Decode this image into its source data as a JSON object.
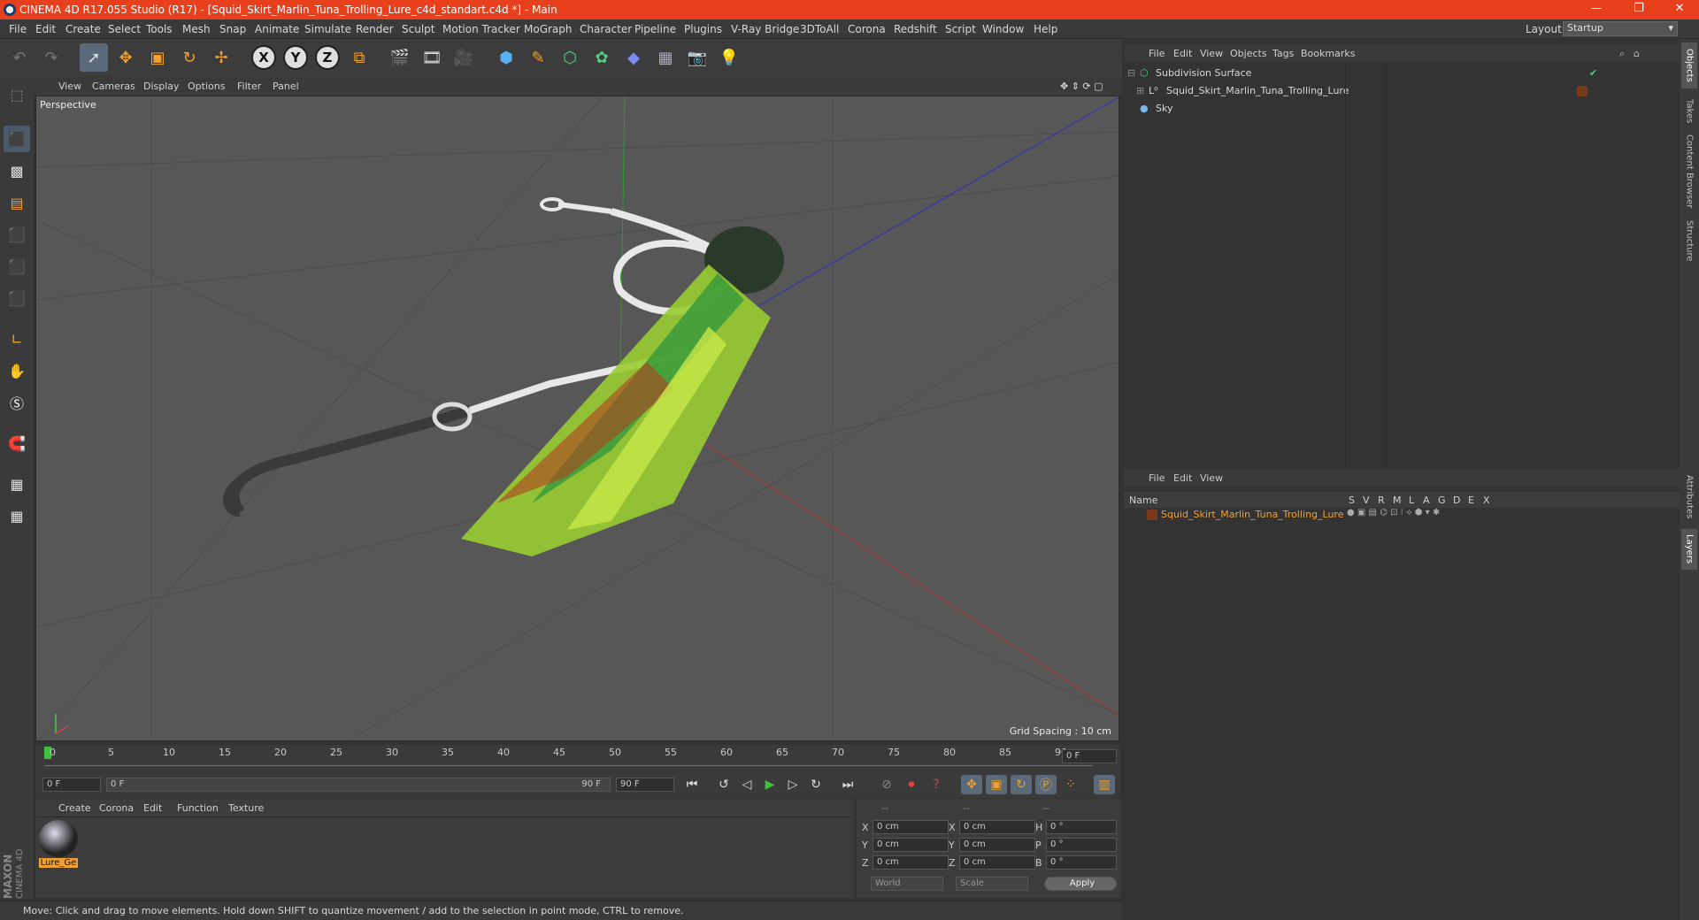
{
  "title_bar": {
    "title": "CINEMA 4D R17.055 Studio (R17) - [Squid_Skirt_Marlin_Tuna_Trolling_Lure_c4d_standart.c4d *] - Main",
    "minimize": "—",
    "restore": "❐",
    "close": "✕"
  },
  "menubar": {
    "items": [
      "File",
      "Edit",
      "Create",
      "Select",
      "Tools",
      "Mesh",
      "Snap",
      "Animate",
      "Simulate",
      "Render",
      "Sculpt",
      "Motion Tracker",
      "MoGraph",
      "Character",
      "Pipeline",
      "Plugins",
      "V-Ray Bridge",
      "3DToAll",
      "Corona",
      "Redshift",
      "Script",
      "Window",
      "Help"
    ],
    "layout_label": "Layout:",
    "layout_value": "Startup"
  },
  "viewport": {
    "menu": [
      "View",
      "Cameras",
      "Display",
      "Options",
      "Filter",
      "Panel"
    ],
    "camera_label": "Perspective",
    "grid_spacing": "Grid Spacing : 10 cm"
  },
  "timeline": {
    "ticks": [
      "0",
      "5",
      "10",
      "15",
      "20",
      "25",
      "30",
      "35",
      "40",
      "45",
      "50",
      "55",
      "60",
      "65",
      "70",
      "75",
      "80",
      "85",
      "90"
    ],
    "end_field": "0 F",
    "start_frame": "0 F",
    "range_start": "0 F",
    "range_end": "90 F",
    "end_frame": "90 F"
  },
  "material_manager": {
    "menu": [
      "Create",
      "Corona",
      "Edit",
      "Function",
      "Texture"
    ],
    "material_name": "Lure_Ge"
  },
  "coordinates": {
    "headers": [
      "--",
      "--",
      "--"
    ],
    "rows": [
      {
        "axis": "X",
        "pos": "0 cm",
        "axis2": "X",
        "size": "0 cm",
        "axis3": "H",
        "rot": "0 °"
      },
      {
        "axis": "Y",
        "pos": "0 cm",
        "axis2": "Y",
        "size": "0 cm",
        "axis3": "P",
        "rot": "0 °"
      },
      {
        "axis": "Z",
        "pos": "0 cm",
        "axis2": "Z",
        "size": "0 cm",
        "axis3": "B",
        "rot": "0 °"
      }
    ],
    "mode1": "World",
    "mode2": "Scale",
    "apply": "Apply"
  },
  "status": "Move: Click and drag to move elements. Hold down SHIFT to quantize movement / add to the selection in point mode, CTRL to remove.",
  "object_manager": {
    "menu": [
      "File",
      "Edit",
      "View",
      "Objects",
      "Tags",
      "Bookmarks"
    ],
    "objects": [
      "Subdivision Surface",
      "Squid_Skirt_Marlin_Tuna_Trolling_Lure",
      "Sky"
    ]
  },
  "layer_manager": {
    "menu": [
      "File",
      "Edit",
      "View"
    ],
    "columns": [
      "Name",
      "S",
      "V",
      "R",
      "M",
      "L",
      "A",
      "G",
      "D",
      "E",
      "X"
    ],
    "layer_name": "Squid_Skirt_Marlin_Tuna_Trolling_Lure"
  },
  "right_tabs": [
    "Objects",
    "Takes",
    "Content Browser",
    "Structure",
    "Attributes",
    "Layers"
  ],
  "brand": {
    "maxon": "MAXON",
    "c4d": "CINEMA 4D"
  },
  "colors": {
    "title_bar": "#e8401c",
    "accent_orange": "#f0a030",
    "layer_color": "#7a3a1a"
  }
}
